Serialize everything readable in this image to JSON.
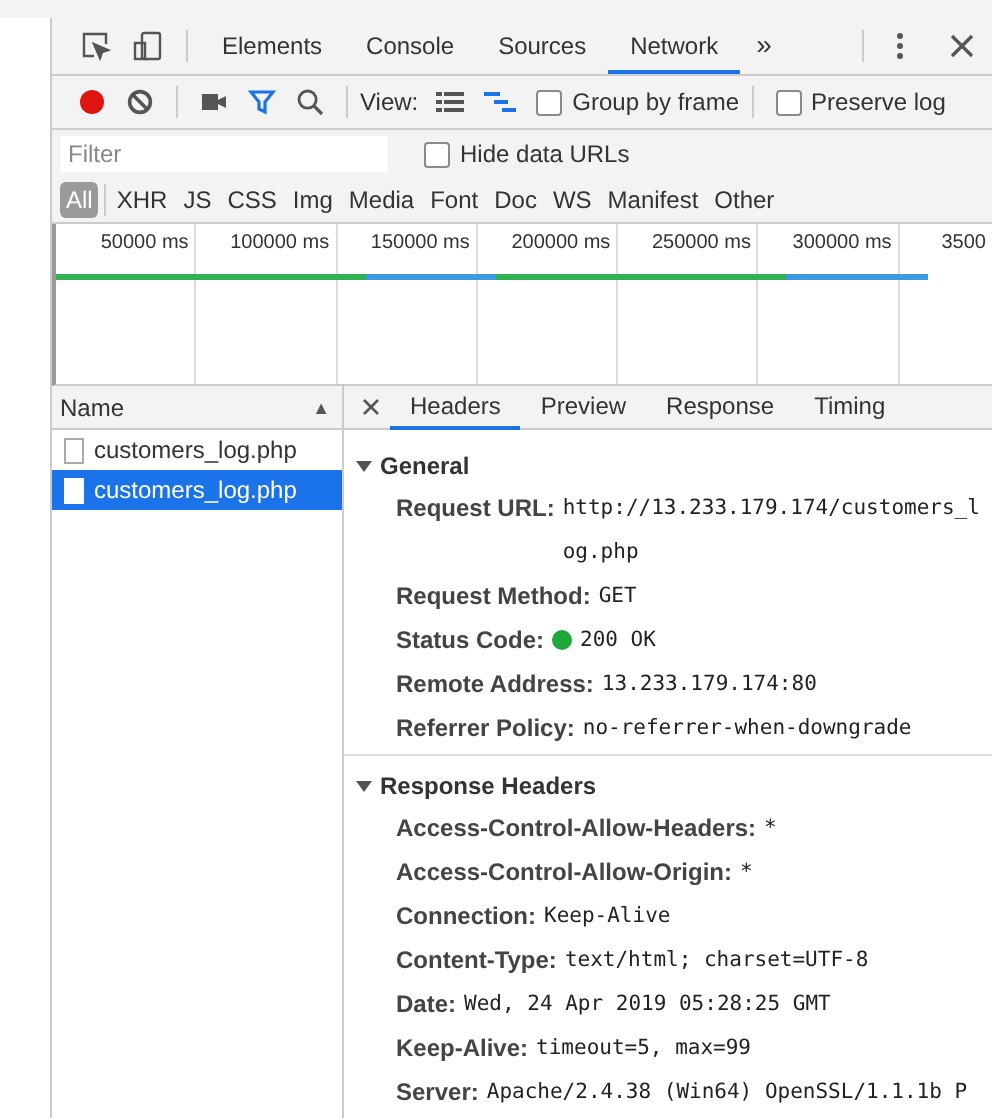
{
  "main_tabs": [
    {
      "label": "Elements",
      "selected": false
    },
    {
      "label": "Console",
      "selected": false
    },
    {
      "label": "Sources",
      "selected": false
    },
    {
      "label": "Network",
      "selected": true
    }
  ],
  "more_tabs": "»",
  "toolbar": {
    "view_label": "View:",
    "options": [
      {
        "label": "Group by frame",
        "checked": false
      },
      {
        "label": "Preserve log",
        "checked": false
      }
    ]
  },
  "filter": {
    "placeholder": "Filter",
    "hide_data_urls": {
      "label": "Hide data URLs",
      "checked": false
    }
  },
  "type_filters": [
    {
      "label": "All",
      "selected": true
    },
    {
      "label": "XHR",
      "selected": false
    },
    {
      "label": "JS",
      "selected": false
    },
    {
      "label": "CSS",
      "selected": false
    },
    {
      "label": "Img",
      "selected": false
    },
    {
      "label": "Media",
      "selected": false
    },
    {
      "label": "Font",
      "selected": false
    },
    {
      "label": "Doc",
      "selected": false
    },
    {
      "label": "WS",
      "selected": false
    },
    {
      "label": "Manifest",
      "selected": false
    },
    {
      "label": "Other",
      "selected": false
    }
  ],
  "timeline": {
    "ticks": [
      "50000 ms",
      "100000 ms",
      "150000 ms",
      "200000 ms",
      "250000 ms",
      "300000 ms",
      "3500"
    ]
  },
  "requests_column": {
    "label": "Name",
    "sort_indicator": "▲"
  },
  "requests": [
    {
      "name": "customers_log.php",
      "selected": false
    },
    {
      "name": "customers_log.php",
      "selected": true
    }
  ],
  "detail_tabs": [
    {
      "label": "Headers",
      "selected": true
    },
    {
      "label": "Preview",
      "selected": false
    },
    {
      "label": "Response",
      "selected": false
    },
    {
      "label": "Timing",
      "selected": false
    }
  ],
  "sections": [
    {
      "title": "General",
      "expanded": true,
      "rows": [
        {
          "label": "Request URL:",
          "value": "http://13.233.179.174/customers_log.php"
        },
        {
          "label": "Request Method:",
          "value": "GET"
        },
        {
          "label": "Status Code:",
          "value": "200 OK",
          "color": "#1fa83a"
        },
        {
          "label": "Remote Address:",
          "value": "13.233.179.174:80"
        },
        {
          "label": "Referrer Policy:",
          "value": "no-referrer-when-downgrade"
        }
      ]
    },
    {
      "title": "Response Headers",
      "expanded": true,
      "rows": [
        {
          "label": "Access-Control-Allow-Headers:",
          "value": "*"
        },
        {
          "label": "Access-Control-Allow-Origin:",
          "value": "*"
        },
        {
          "label": "Connection:",
          "value": "Keep-Alive"
        },
        {
          "label": "Content-Type:",
          "value": "text/html; charset=UTF-8"
        },
        {
          "label": "Date:",
          "value": "Wed, 24 Apr 2019 05:28:25 GMT"
        },
        {
          "label": "Keep-Alive:",
          "value": "timeout=5, max=99"
        },
        {
          "label": "Server:",
          "value": "Apache/2.4.38 (Win64) OpenSSL/1.1.1b P"
        }
      ]
    }
  ]
}
